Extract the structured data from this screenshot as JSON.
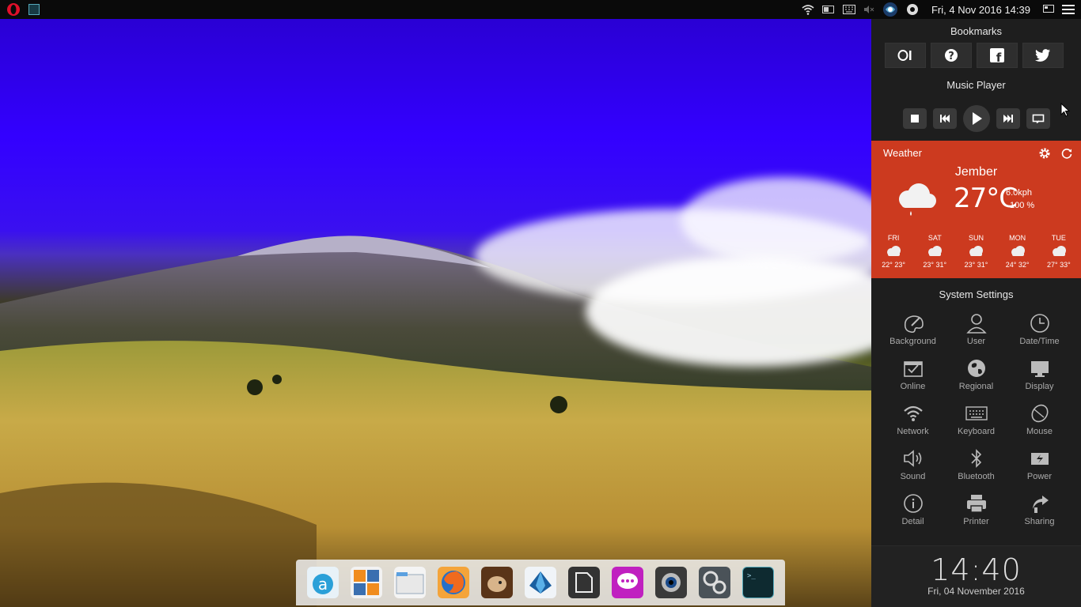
{
  "topbar": {
    "datetime": "Fri, 4 Nov 2016 14:39",
    "left_icons": [
      "opera-icon",
      "terminal-icon"
    ],
    "right_icons": [
      "wifi-icon",
      "battery-icon",
      "keyboard-icon",
      "mute-icon",
      "steam-icon",
      "skype-icon",
      "screen-icon",
      "menu-icon"
    ]
  },
  "panel": {
    "bookmarks": {
      "title": "Bookmarks",
      "items": [
        "opera-icon",
        "help-icon",
        "facebook-icon",
        "twitter-icon"
      ]
    },
    "music_player": {
      "title": "Music Player",
      "controls": [
        "stop-icon",
        "previous-icon",
        "play-icon",
        "next-icon",
        "repeat-icon"
      ]
    },
    "weather": {
      "title": "Weather",
      "city": "Jember",
      "temp": "27°C",
      "wind": "6.0kph",
      "humidity": "100 %",
      "forecast": [
        {
          "day": "FRI",
          "range": "22° 23°"
        },
        {
          "day": "SAT",
          "range": "23° 31°"
        },
        {
          "day": "SUN",
          "range": "23° 31°"
        },
        {
          "day": "MON",
          "range": "24° 32°"
        },
        {
          "day": "TUE",
          "range": "27° 33°"
        }
      ],
      "accent": "#cc3a1f"
    },
    "system_settings": {
      "title": "System Settings",
      "items": [
        {
          "label": "Background"
        },
        {
          "label": "User"
        },
        {
          "label": "Date/Time"
        },
        {
          "label": "Online"
        },
        {
          "label": "Regional"
        },
        {
          "label": "Display"
        },
        {
          "label": "Network"
        },
        {
          "label": "Keyboard"
        },
        {
          "label": "Mouse"
        },
        {
          "label": "Sound"
        },
        {
          "label": "Bluetooth"
        },
        {
          "label": "Power"
        },
        {
          "label": "Detail"
        },
        {
          "label": "Printer"
        },
        {
          "label": "Sharing"
        }
      ]
    },
    "clock": {
      "time": "14:40",
      "date": "Fri, 04 November 2016"
    }
  },
  "dock": {
    "items": [
      "app-center-icon",
      "calculator-icon",
      "files-icon",
      "firefox-icon",
      "app-icon",
      "app-icon-2",
      "notes-icon",
      "messenger-icon",
      "webcam-icon",
      "settings-icon",
      "terminal-icon"
    ]
  }
}
